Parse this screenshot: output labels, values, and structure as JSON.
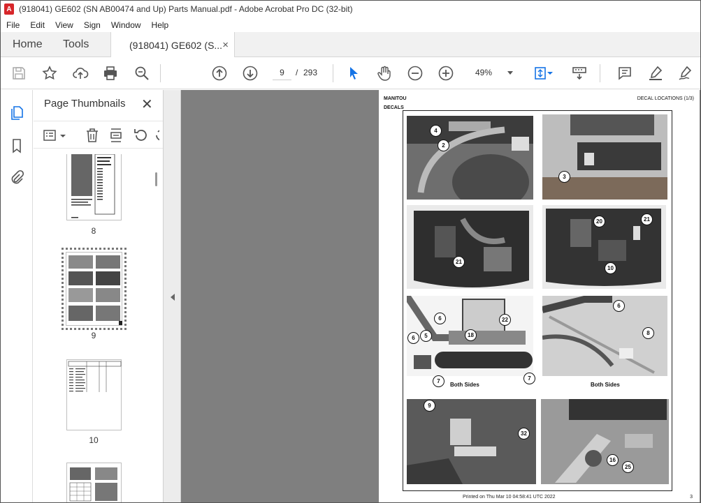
{
  "window": {
    "title": "(918041) GE602 (SN AB00474 and Up) Parts Manual.pdf - Adobe Acrobat Pro DC (32-bit)",
    "app_icon": "A"
  },
  "menu": {
    "items": [
      "File",
      "Edit",
      "View",
      "Sign",
      "Window",
      "Help"
    ]
  },
  "tabs": {
    "home": "Home",
    "tools": "Tools",
    "document": "(918041) GE602 (S...",
    "close_glyph": "×"
  },
  "toolbar": {
    "icons": [
      "save-icon",
      "bookmark-star-icon",
      "upload-icon",
      "print-icon",
      "zoom-search-icon",
      "page-up-icon",
      "page-down-icon",
      "select-cursor-icon",
      "hand-icon",
      "zoom-out-icon",
      "zoom-in-icon",
      "fit-page-icon",
      "scroll-mode-icon",
      "comment-icon",
      "highlight-icon",
      "sign-icon"
    ],
    "current_page": "9",
    "page_separator": "/",
    "total_pages": "293",
    "zoom": "49%",
    "accent_color": "#1473e6"
  },
  "sidebar": {
    "rail_icons": [
      "page-thumbnails-icon",
      "bookmarks-icon",
      "attachments-icon"
    ],
    "panel_title": "Page Thumbnails",
    "close_glyph": "✕",
    "thumbnails": [
      {
        "label": "8"
      },
      {
        "label": "9",
        "selected": true
      },
      {
        "label": "10"
      }
    ]
  },
  "document_page": {
    "header_left": "MANITOU",
    "header_right": "DECAL LOCATIONS (1/3)",
    "section": "DECALS",
    "footer": "Printed on  Thu Mar 10 04:58:41 UTC 2022",
    "page_number": "3",
    "captions": [
      "Both Sides",
      "Both Sides"
    ],
    "callouts": [
      "4",
      "2",
      "3",
      "21",
      "20",
      "21",
      "10",
      "6",
      "22",
      "5",
      "18",
      "6",
      "7",
      "7",
      "6",
      "8",
      "9",
      "32",
      "16",
      "25"
    ]
  }
}
